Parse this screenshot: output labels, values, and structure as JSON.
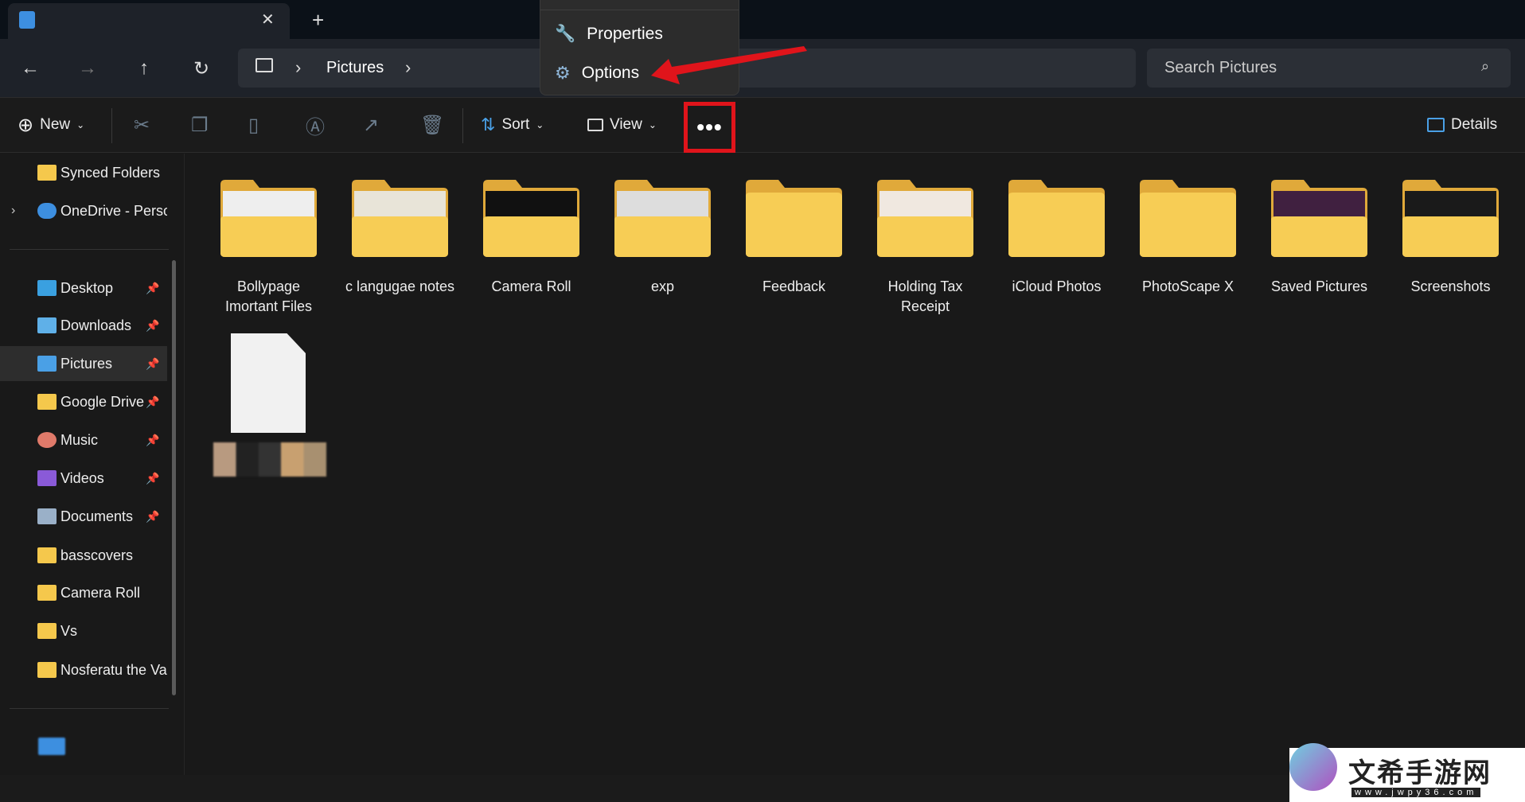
{
  "tab": {
    "close": "✕",
    "new_tab": "+"
  },
  "nav": {
    "back": "←",
    "forward": "→",
    "up": "↑",
    "refresh": "↻"
  },
  "address": {
    "sep": "›",
    "path": [
      "Pictures"
    ]
  },
  "search": {
    "placeholder": "Search Pictures"
  },
  "toolbar": {
    "new": "New",
    "sort": "Sort",
    "view": "View",
    "more": "•••",
    "details": "Details"
  },
  "menu": {
    "items": [
      {
        "label": "Properties",
        "icon": "wrench-icon"
      },
      {
        "label": "Options",
        "icon": "gear-icon"
      }
    ]
  },
  "sidebar": {
    "items": [
      {
        "label": "Synced Folders",
        "icon": "folder"
      },
      {
        "label": "OneDrive - Personal",
        "icon": "cloud"
      },
      {
        "label": "Desktop",
        "icon": "desktop",
        "pinned": true
      },
      {
        "label": "Downloads",
        "icon": "download",
        "pinned": true
      },
      {
        "label": "Pictures",
        "icon": "pictures",
        "pinned": true,
        "selected": true
      },
      {
        "label": "Google Drive",
        "icon": "folder",
        "pinned": true
      },
      {
        "label": "Music",
        "icon": "music",
        "pinned": true
      },
      {
        "label": "Videos",
        "icon": "videos",
        "pinned": true
      },
      {
        "label": "Documents",
        "icon": "documents",
        "pinned": true
      },
      {
        "label": "basscovers",
        "icon": "folder"
      },
      {
        "label": "Camera Roll",
        "icon": "folder"
      },
      {
        "label": "Vs",
        "icon": "folder"
      },
      {
        "label": "Nosferatu the Vampyre",
        "icon": "folder"
      }
    ]
  },
  "content": {
    "folders": [
      {
        "l1": "Bollypage",
        "l2": "Imortant Files"
      },
      {
        "l1": "c langugae notes",
        "l2": ""
      },
      {
        "l1": "Camera Roll",
        "l2": ""
      },
      {
        "l1": "exp",
        "l2": ""
      },
      {
        "l1": "Feedback",
        "l2": ""
      },
      {
        "l1": "Holding Tax",
        "l2": "Receipt"
      },
      {
        "l1": "iCloud Photos",
        "l2": ""
      },
      {
        "l1": "PhotoScape X",
        "l2": ""
      },
      {
        "l1": "Saved Pictures",
        "l2": ""
      },
      {
        "l1": "Screenshots",
        "l2": ""
      }
    ]
  },
  "watermark": {
    "text": "文希手游网",
    "url": "www.jwpy36.com"
  },
  "colors": {
    "folder": "#f5c84c",
    "highlight": "#e0141b",
    "accent": "#4aa0e6"
  }
}
